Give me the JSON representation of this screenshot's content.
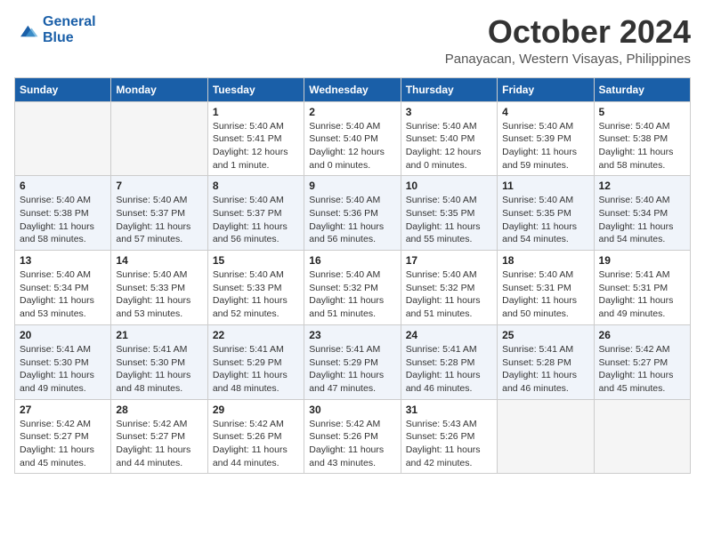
{
  "logo": {
    "line1": "General",
    "line2": "Blue"
  },
  "title": "October 2024",
  "subtitle": "Panayacan, Western Visayas, Philippines",
  "weekdays": [
    "Sunday",
    "Monday",
    "Tuesday",
    "Wednesday",
    "Thursday",
    "Friday",
    "Saturday"
  ],
  "weeks": [
    [
      {
        "day": "",
        "sunrise": "",
        "sunset": "",
        "daylight": ""
      },
      {
        "day": "",
        "sunrise": "",
        "sunset": "",
        "daylight": ""
      },
      {
        "day": "1",
        "sunrise": "Sunrise: 5:40 AM",
        "sunset": "Sunset: 5:41 PM",
        "daylight": "Daylight: 12 hours and 1 minute."
      },
      {
        "day": "2",
        "sunrise": "Sunrise: 5:40 AM",
        "sunset": "Sunset: 5:40 PM",
        "daylight": "Daylight: 12 hours and 0 minutes."
      },
      {
        "day": "3",
        "sunrise": "Sunrise: 5:40 AM",
        "sunset": "Sunset: 5:40 PM",
        "daylight": "Daylight: 12 hours and 0 minutes."
      },
      {
        "day": "4",
        "sunrise": "Sunrise: 5:40 AM",
        "sunset": "Sunset: 5:39 PM",
        "daylight": "Daylight: 11 hours and 59 minutes."
      },
      {
        "day": "5",
        "sunrise": "Sunrise: 5:40 AM",
        "sunset": "Sunset: 5:38 PM",
        "daylight": "Daylight: 11 hours and 58 minutes."
      }
    ],
    [
      {
        "day": "6",
        "sunrise": "Sunrise: 5:40 AM",
        "sunset": "Sunset: 5:38 PM",
        "daylight": "Daylight: 11 hours and 58 minutes."
      },
      {
        "day": "7",
        "sunrise": "Sunrise: 5:40 AM",
        "sunset": "Sunset: 5:37 PM",
        "daylight": "Daylight: 11 hours and 57 minutes."
      },
      {
        "day": "8",
        "sunrise": "Sunrise: 5:40 AM",
        "sunset": "Sunset: 5:37 PM",
        "daylight": "Daylight: 11 hours and 56 minutes."
      },
      {
        "day": "9",
        "sunrise": "Sunrise: 5:40 AM",
        "sunset": "Sunset: 5:36 PM",
        "daylight": "Daylight: 11 hours and 56 minutes."
      },
      {
        "day": "10",
        "sunrise": "Sunrise: 5:40 AM",
        "sunset": "Sunset: 5:35 PM",
        "daylight": "Daylight: 11 hours and 55 minutes."
      },
      {
        "day": "11",
        "sunrise": "Sunrise: 5:40 AM",
        "sunset": "Sunset: 5:35 PM",
        "daylight": "Daylight: 11 hours and 54 minutes."
      },
      {
        "day": "12",
        "sunrise": "Sunrise: 5:40 AM",
        "sunset": "Sunset: 5:34 PM",
        "daylight": "Daylight: 11 hours and 54 minutes."
      }
    ],
    [
      {
        "day": "13",
        "sunrise": "Sunrise: 5:40 AM",
        "sunset": "Sunset: 5:34 PM",
        "daylight": "Daylight: 11 hours and 53 minutes."
      },
      {
        "day": "14",
        "sunrise": "Sunrise: 5:40 AM",
        "sunset": "Sunset: 5:33 PM",
        "daylight": "Daylight: 11 hours and 53 minutes."
      },
      {
        "day": "15",
        "sunrise": "Sunrise: 5:40 AM",
        "sunset": "Sunset: 5:33 PM",
        "daylight": "Daylight: 11 hours and 52 minutes."
      },
      {
        "day": "16",
        "sunrise": "Sunrise: 5:40 AM",
        "sunset": "Sunset: 5:32 PM",
        "daylight": "Daylight: 11 hours and 51 minutes."
      },
      {
        "day": "17",
        "sunrise": "Sunrise: 5:40 AM",
        "sunset": "Sunset: 5:32 PM",
        "daylight": "Daylight: 11 hours and 51 minutes."
      },
      {
        "day": "18",
        "sunrise": "Sunrise: 5:40 AM",
        "sunset": "Sunset: 5:31 PM",
        "daylight": "Daylight: 11 hours and 50 minutes."
      },
      {
        "day": "19",
        "sunrise": "Sunrise: 5:41 AM",
        "sunset": "Sunset: 5:31 PM",
        "daylight": "Daylight: 11 hours and 49 minutes."
      }
    ],
    [
      {
        "day": "20",
        "sunrise": "Sunrise: 5:41 AM",
        "sunset": "Sunset: 5:30 PM",
        "daylight": "Daylight: 11 hours and 49 minutes."
      },
      {
        "day": "21",
        "sunrise": "Sunrise: 5:41 AM",
        "sunset": "Sunset: 5:30 PM",
        "daylight": "Daylight: 11 hours and 48 minutes."
      },
      {
        "day": "22",
        "sunrise": "Sunrise: 5:41 AM",
        "sunset": "Sunset: 5:29 PM",
        "daylight": "Daylight: 11 hours and 48 minutes."
      },
      {
        "day": "23",
        "sunrise": "Sunrise: 5:41 AM",
        "sunset": "Sunset: 5:29 PM",
        "daylight": "Daylight: 11 hours and 47 minutes."
      },
      {
        "day": "24",
        "sunrise": "Sunrise: 5:41 AM",
        "sunset": "Sunset: 5:28 PM",
        "daylight": "Daylight: 11 hours and 46 minutes."
      },
      {
        "day": "25",
        "sunrise": "Sunrise: 5:41 AM",
        "sunset": "Sunset: 5:28 PM",
        "daylight": "Daylight: 11 hours and 46 minutes."
      },
      {
        "day": "26",
        "sunrise": "Sunrise: 5:42 AM",
        "sunset": "Sunset: 5:27 PM",
        "daylight": "Daylight: 11 hours and 45 minutes."
      }
    ],
    [
      {
        "day": "27",
        "sunrise": "Sunrise: 5:42 AM",
        "sunset": "Sunset: 5:27 PM",
        "daylight": "Daylight: 11 hours and 45 minutes."
      },
      {
        "day": "28",
        "sunrise": "Sunrise: 5:42 AM",
        "sunset": "Sunset: 5:27 PM",
        "daylight": "Daylight: 11 hours and 44 minutes."
      },
      {
        "day": "29",
        "sunrise": "Sunrise: 5:42 AM",
        "sunset": "Sunset: 5:26 PM",
        "daylight": "Daylight: 11 hours and 44 minutes."
      },
      {
        "day": "30",
        "sunrise": "Sunrise: 5:42 AM",
        "sunset": "Sunset: 5:26 PM",
        "daylight": "Daylight: 11 hours and 43 minutes."
      },
      {
        "day": "31",
        "sunrise": "Sunrise: 5:43 AM",
        "sunset": "Sunset: 5:26 PM",
        "daylight": "Daylight: 11 hours and 42 minutes."
      },
      {
        "day": "",
        "sunrise": "",
        "sunset": "",
        "daylight": ""
      },
      {
        "day": "",
        "sunrise": "",
        "sunset": "",
        "daylight": ""
      }
    ]
  ]
}
